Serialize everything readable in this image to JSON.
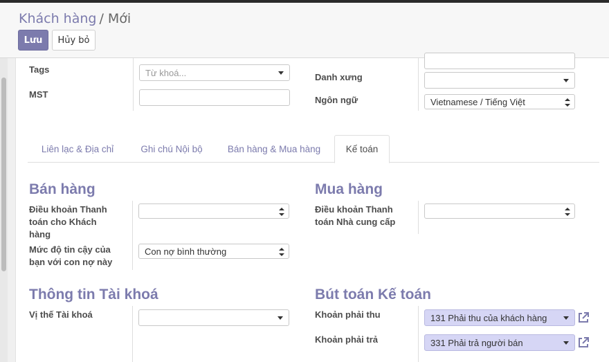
{
  "breadcrumb": {
    "parent": "Khách hàng",
    "separator": "/",
    "current": "Mới"
  },
  "toolbar": {
    "save_label": "Lưu",
    "discard_label": "Hủy bỏ"
  },
  "form": {
    "tags": {
      "label": "Tags",
      "placeholder": "Từ khoá..."
    },
    "vat": {
      "label": "MST",
      "value": ""
    },
    "title": {
      "label": "Danh xưng",
      "value": ""
    },
    "language": {
      "label": "Ngôn ngữ",
      "value": "Vietnamese / Tiếng Việt"
    }
  },
  "tabs": [
    {
      "label": "Liên lạc & Địa chỉ",
      "active": false
    },
    {
      "label": "Ghi chú Nội bộ",
      "active": false
    },
    {
      "label": "Bán hàng & Mua hàng",
      "active": false
    },
    {
      "label": "Kế toán",
      "active": true
    }
  ],
  "accounting": {
    "sales": {
      "heading": "Bán hàng",
      "payment_terms": {
        "label_lines": [
          "Điều khoản Thanh",
          "toán cho Khách",
          "hàng"
        ],
        "value": ""
      },
      "trust": {
        "label_lines": [
          "Mức độ tin cậy của",
          "bạn với con nợ này"
        ],
        "value": "Con nợ bình thường"
      }
    },
    "purchase": {
      "heading": "Mua hàng",
      "payment_terms": {
        "label_lines": [
          "Điều khoản Thanh",
          "toán Nhà cung cấp"
        ],
        "value": ""
      }
    },
    "fiscal": {
      "heading": "Thông tin Tài khoá",
      "position": {
        "label": "Vị thế Tài khoá",
        "value": ""
      }
    },
    "entries": {
      "heading": "Bút toán Kế toán",
      "receivable": {
        "label": "Khoản phải thu",
        "value": "131 Phải thu của khách hàng"
      },
      "payable": {
        "label": "Khoản phải trả",
        "value": "331 Phải trả người bán"
      }
    }
  },
  "icons": {
    "external_link": "external-link-icon",
    "dropdown": "caret-down-icon",
    "select": "select-arrows-icon"
  },
  "colors": {
    "brand": "#7c7bad",
    "many2one_bg": "#d6d6f5"
  }
}
